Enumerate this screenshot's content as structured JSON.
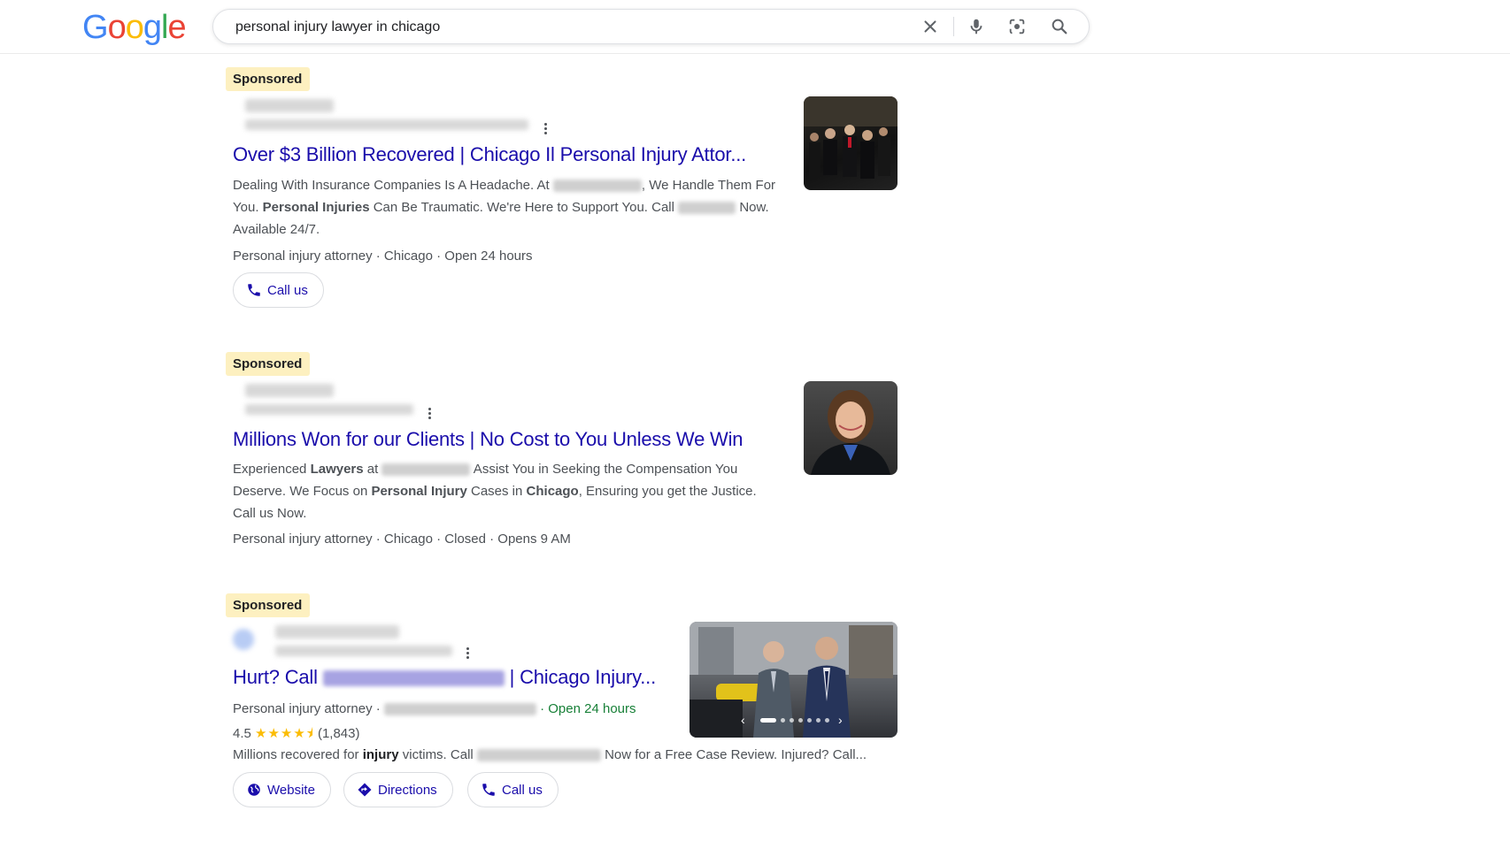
{
  "logo": {
    "text": "Google"
  },
  "search": {
    "query": "personal injury lawyer in chicago"
  },
  "colors": {
    "link": "#1a0dab",
    "sponsored_bg": "#fdf0c0",
    "open_green": "#188038",
    "star": "#fbbc04"
  },
  "ads": [
    {
      "sponsored": "Sponsored",
      "title": "Over $3 Billion Recovered | Chicago Il Personal Injury Attor...",
      "desc": {
        "p1": "Dealing With Insurance Companies Is A Headache. At ",
        "p2": ", We Handle Them For You. ",
        "b1": "Personal Injuries",
        "p3": " Can Be Traumatic. We're Here to Support You. Call ",
        "p4": " Now. Available 24/7."
      },
      "meta": "Personal injury attorney · Chicago · Open 24 hours",
      "chips": [
        "Call us"
      ]
    },
    {
      "sponsored": "Sponsored",
      "title": "Millions Won for our Clients | No Cost to You Unless We Win",
      "desc": {
        "p1": "Experienced ",
        "b1": "Lawyers",
        "p2": " at ",
        "p3": " Assist You in Seeking the Compensation You Deserve. We Focus on ",
        "b2": "Personal Injury",
        "p4": " Cases in ",
        "b3": "Chicago",
        "p5": ", Ensuring you get the Justice. Call us Now."
      },
      "meta": "Personal injury attorney · Chicago · Closed · Opens 9 AM"
    },
    {
      "sponsored": "Sponsored",
      "title_pre": "Hurt? Call ",
      "title_post": " | Chicago Injury...",
      "meta_pre": "Personal injury attorney · ",
      "meta_open": "· Open 24 hours",
      "rating": "4.5",
      "stars": "★★★★⯨",
      "reviews": "(1,843)",
      "desc": {
        "p1": "Millions recovered for ",
        "b1": "injury",
        "p2": " victims. Call ",
        "p3": " Now for a Free Case Review. Injured? Call..."
      },
      "chips": [
        "Website",
        "Directions",
        "Call us"
      ]
    }
  ]
}
